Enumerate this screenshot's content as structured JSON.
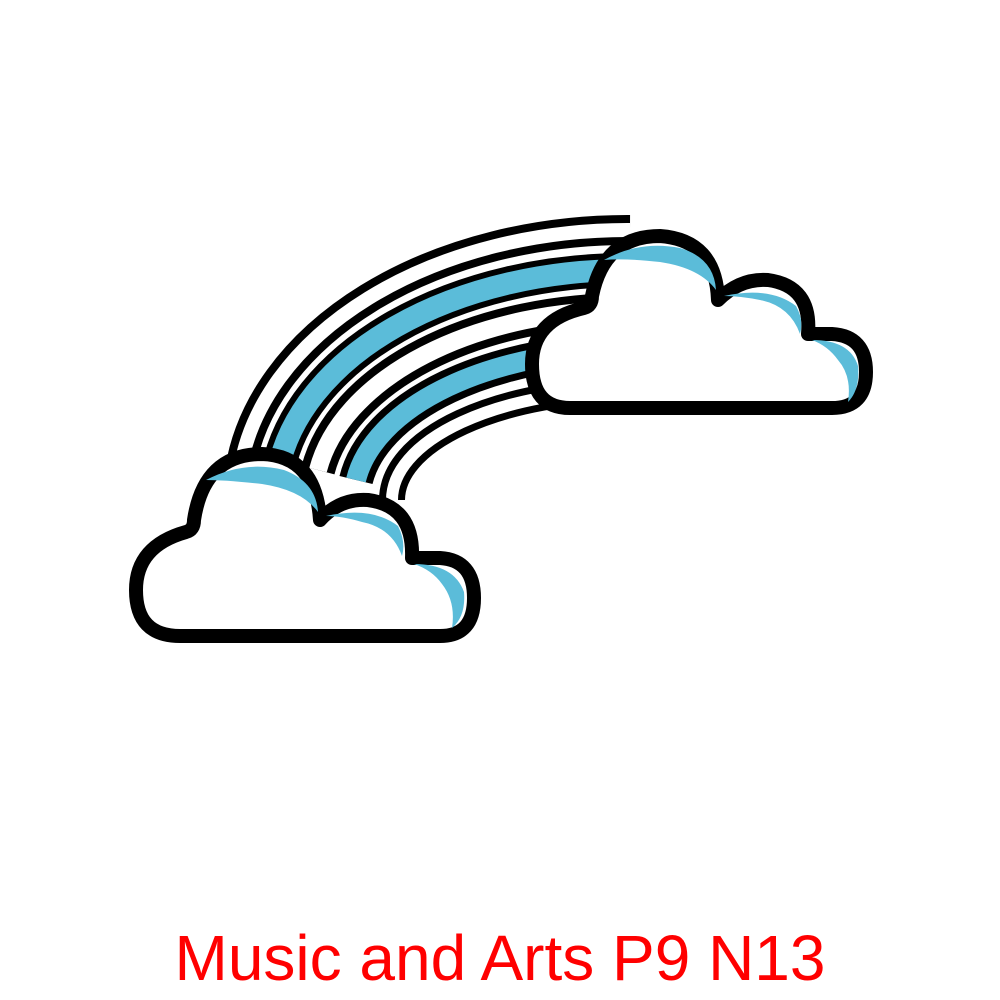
{
  "illustration": {
    "icon": "rainbow-with-clouds-icon",
    "colors": {
      "outline": "#000000",
      "stripe": "#5bbcd9",
      "fill": "#ffffff",
      "cloud_shadow": "#5bbcd9"
    }
  },
  "caption": {
    "text": "Music and Arts P9 N13",
    "color": "#ff0000"
  }
}
